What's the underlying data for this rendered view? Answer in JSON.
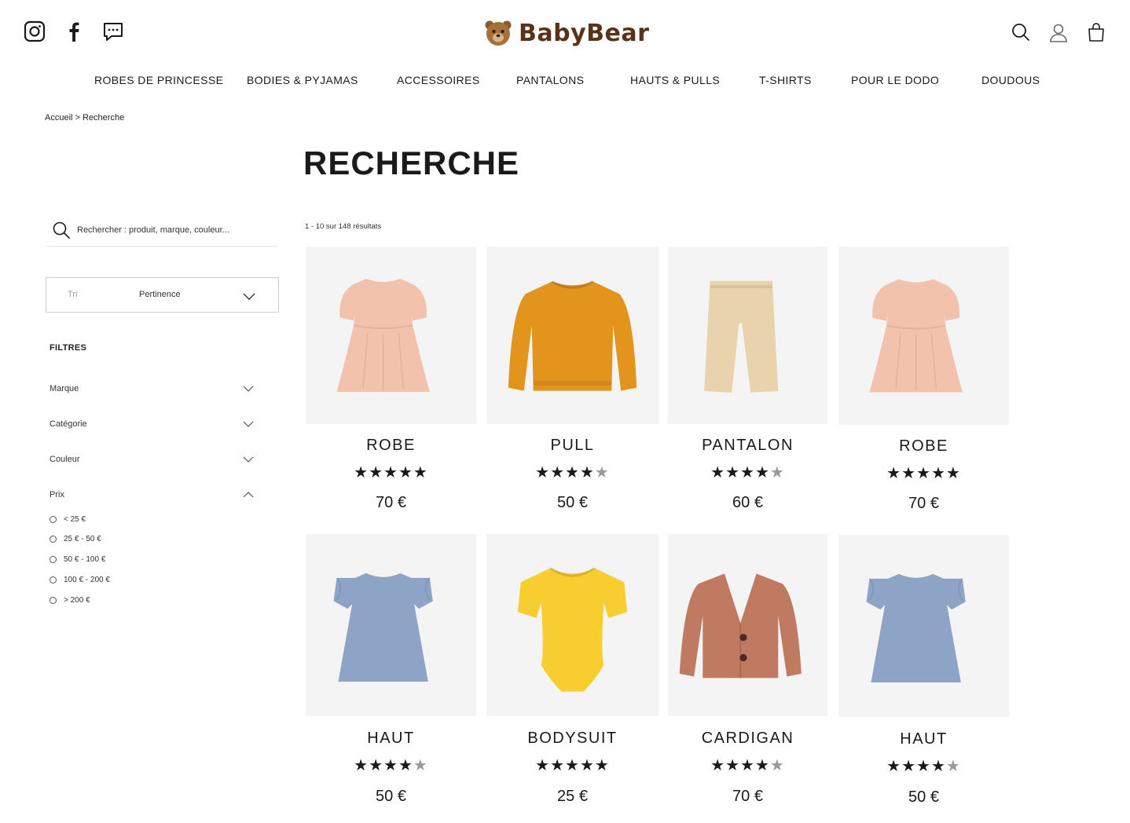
{
  "header": {
    "brand": "BabyBear",
    "social_icons": [
      "instagram-icon",
      "facebook-icon",
      "chat-icon"
    ],
    "user_icons": [
      "search-icon",
      "account-icon",
      "bag-icon"
    ]
  },
  "nav": {
    "items": [
      "ROBES DE PRINCESSE",
      "BODIES & PYJAMAS",
      "ACCESSOIRES",
      "PANTALONS",
      "HAUTS & PULLS",
      "T-SHIRTS",
      "POUR LE DODO",
      "DOUDOUS"
    ]
  },
  "breadcrumb": "Accueil > Recherche",
  "page_title": "RECHERCHE",
  "sidebar": {
    "search_placeholder": "Rechercher : produit, marque, couleur...",
    "sort_label": "Tri",
    "sort_value": "Pertinence",
    "filters_title": "FILTRES",
    "filters": [
      "Marque",
      "Catégorie",
      "Couleur",
      "Prix"
    ],
    "price_options": [
      "< 25 €",
      "25 € - 50 €",
      "50 € - 100 €",
      "100 € - 200 €",
      "> 200 €"
    ]
  },
  "results_count": "1 - 10 sur 148 résultats",
  "colors": {
    "text": "#1a1a1a",
    "brand": "#5a3217",
    "image_bg": "#f4f4f4",
    "star_on": "#1a1a1a",
    "star_off": "#9a9a9a"
  },
  "products": [
    {
      "name": "ROBE",
      "rating": 5,
      "price": "70 €",
      "image": "pink-dress",
      "color": "#f2c2ad"
    },
    {
      "name": "PULL",
      "rating": 4,
      "price": "50 €",
      "image": "orange-sweater",
      "color": "#e3941c"
    },
    {
      "name": "PANTALON",
      "rating": 4,
      "price": "60 €",
      "image": "beige-pants",
      "color": "#e9d3ad"
    },
    {
      "name": "ROBE",
      "rating": 5,
      "price": "70 €",
      "image": "pink-dress",
      "color": "#f2c2ad"
    },
    {
      "name": "HAUT",
      "rating": 4,
      "price": "50 €",
      "image": "blue-top",
      "color": "#8ea4c7"
    },
    {
      "name": "BODYSUIT",
      "rating": 5,
      "price": "25 €",
      "image": "yellow-bodysuit",
      "color": "#f8cd2f"
    },
    {
      "name": "CARDIGAN",
      "rating": 4,
      "price": "70 €",
      "image": "rust-cardigan",
      "color": "#c17a62"
    },
    {
      "name": "HAUT",
      "rating": 4,
      "price": "50 €",
      "image": "blue-top",
      "color": "#8ea4c7"
    }
  ]
}
